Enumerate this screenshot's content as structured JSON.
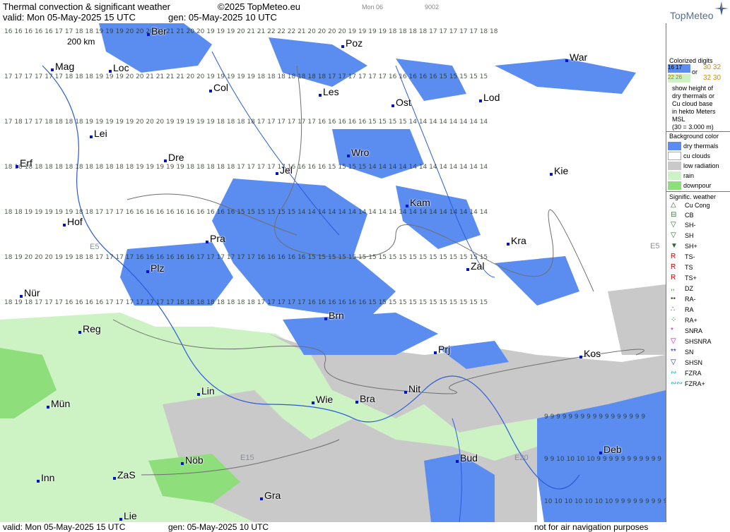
{
  "header": {
    "title": "Thermal convection & significant weather",
    "copyright": "©2025 TopMeteo.eu",
    "valid": "valid:  Mon  05-May-2025  15 UTC",
    "gen": "gen: 05-May-2025 10 UTC",
    "small1": "Mon 06",
    "small2": "9002",
    "brand": "TopMeteo"
  },
  "map": {
    "scale_label": "200 km",
    "cities": [
      "Ber",
      "Poz",
      "War",
      "Mag",
      "Loc",
      "Col",
      "Les",
      "Lod",
      "Ost",
      "Lei",
      "Dre",
      "Jel",
      "Wro",
      "Kie",
      "Erf",
      "Kam",
      "Hof",
      "Pra",
      "Kra",
      "Plz",
      "Zal",
      "Nür",
      "Brn",
      "Reg",
      "Prj",
      "Kos",
      "Lin",
      "Nit",
      "Mün",
      "Wie",
      "Bra",
      "Nöb",
      "Bud",
      "Deb",
      "Inn",
      "ZaS",
      "Gra",
      "Lie"
    ],
    "roads": [
      "E15",
      "E20",
      "E5",
      "E5"
    ]
  },
  "legend": {
    "colorized_title": "Colorized digits",
    "sample_a": "16  17",
    "sample_b": "22  26",
    "or_label": "or",
    "sample_c": "30 32",
    "sample_d": "32 30",
    "desc1": "show height of",
    "desc2": "dry thermals or",
    "desc3": "Cu cloud base",
    "desc4": "in hekto Meters",
    "desc5": "MSL",
    "desc6": "(30 = 3.000 m)",
    "bg_title": "Background color",
    "bg_items": [
      "dry thermals",
      "cu clouds",
      "low radiation",
      "rain",
      "downpour"
    ],
    "bg_colors": [
      "#5b8cf0",
      "#ffffff",
      "#c9c9c9",
      "#cdf2c4",
      "#8edf7c"
    ],
    "sig_title": "Signific. weather",
    "sig_items": [
      "Cu Cong",
      "CB",
      "SH-",
      "SH",
      "SH+",
      "TS-",
      "TS",
      "TS+",
      "DZ",
      "RA-",
      "RA",
      "RA+",
      "SNRA",
      "SHSNRA",
      "SN",
      "SHSN",
      "FZRA",
      "FZRA+"
    ]
  },
  "footer": {
    "valid": "valid:  Mon  05-May-2025  15 UTC",
    "gen": "gen: 05-May-2025 10 UTC",
    "note": "not for air navigation purposes"
  }
}
